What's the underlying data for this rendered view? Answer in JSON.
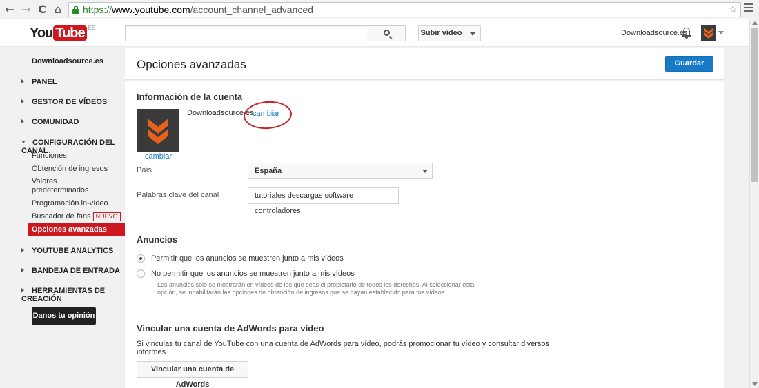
{
  "browser": {
    "url_scheme": "https://",
    "url_host": "www.youtube.com",
    "url_path": "/account_channel_advanced",
    "back_icon": "←",
    "forward_icon": "→",
    "reload_icon": "C",
    "home_icon": "⌂",
    "star_icon": "☆"
  },
  "header": {
    "logo_you": "You",
    "logo_tube": "Tube",
    "logo_region": "ES",
    "search_placeholder": "",
    "upload_label": "Subir vídeo",
    "user_name": "Downloadsource.es"
  },
  "sidebar": {
    "channel_name": "Downloadsource.es",
    "items": [
      {
        "label": "PANEL"
      },
      {
        "label": "GESTOR DE VÍDEOS"
      },
      {
        "label": "COMUNIDAD"
      },
      {
        "label": "CONFIGURACIÓN DEL CANAL"
      },
      {
        "label": "YOUTUBE ANALYTICS"
      },
      {
        "label": "BANDEJA DE ENTRADA"
      },
      {
        "label": "HERRAMIENTAS DE CREACIÓN"
      }
    ],
    "sub_items": [
      {
        "label": "Funciones"
      },
      {
        "label": "Obtención de ingresos"
      },
      {
        "label": "Valores predeterminados"
      },
      {
        "label": "Programación in-vídeo"
      },
      {
        "label": "Buscador de fans"
      },
      {
        "label": "Opciones avanzadas"
      }
    ],
    "new_badge": "NUEVO",
    "feedback_label": "Danos tu opinión"
  },
  "page": {
    "title": "Opciones avanzadas",
    "save_label": "Guardar"
  },
  "account": {
    "section_title": "Información de la cuenta",
    "name": "Downloadsource.es",
    "change_label": "cambiar",
    "avatar_change_label": "cambiar",
    "country_label": "País",
    "country_value": "España",
    "keywords_label": "Palabras clave del canal",
    "keywords_value": "tutoriales descargas software controladores"
  },
  "ads": {
    "section_title": "Anuncios",
    "option_allow": "Permitir que los anuncios se muestren junto a mis vídeos",
    "option_deny": "No permitir que los anuncios se muestren junto a mis vídeos",
    "help": "Los anuncios solo se mostrarán en vídeos de los que seas el propietario de todos los derechos. Al seleccionar esta opción, se inhabilitarán las opciones de obtención de ingresos que se hayan establecido para tus vídeos.",
    "selected": "allow"
  },
  "adwords": {
    "section_title": "Vincular una cuenta de AdWords para vídeo",
    "description": "Si vinculas tu canal de YouTube con una cuenta de AdWords para vídeo, podrás promocionar tu vídeo y consultar diversos informes.",
    "button_label": "Vincular una cuenta de AdWords"
  },
  "colors": {
    "brand_red": "#cc181e",
    "link_blue": "#167ac6",
    "avatar_orange": "#e8611c"
  }
}
